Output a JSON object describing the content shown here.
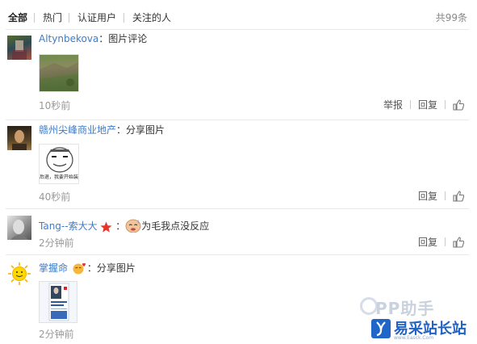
{
  "tabs": [
    {
      "label": "全部",
      "active": true
    },
    {
      "label": "热门",
      "active": false
    },
    {
      "label": "认证用户",
      "active": false
    },
    {
      "label": "关注的人",
      "active": false
    }
  ],
  "total": "共99条",
  "actions": {
    "report": "举报",
    "reply": "回复"
  },
  "comments": [
    {
      "user": "Altynbekova",
      "text": "：图片评论",
      "time": "10秒前",
      "has_report": true,
      "avatar_icon": "avatar-icon",
      "image": "landscape-photo"
    },
    {
      "user": "赣州尖峰商业地产",
      "text": "：分享图片",
      "time": "40秒前",
      "has_report": false,
      "avatar_icon": "avatar-icon",
      "image": "meme-image",
      "image_caption": "后退，我要开始装逼了"
    },
    {
      "user": "Tang--索大大",
      "text": "为毛我点没反应",
      "time": "2分钟前",
      "has_report": false,
      "avatar_icon": "avatar-icon",
      "badge_icon": "star-icon",
      "emoji_icon": "sweat-emoji-icon"
    },
    {
      "user": "掌握命",
      "text": "：分享图片",
      "time": "2分钟前",
      "has_report": false,
      "avatar_icon": "sun-avatar-icon",
      "badge_icon": "heart-emoji-icon",
      "image": "book-cover-image"
    }
  ],
  "watermarks": {
    "top": "PP助手",
    "bottom": "易采站长站",
    "bottom_sub": "www.Easck.Com"
  },
  "colors": {
    "link": "#3e7bc8",
    "time": "#999999",
    "divider": "#e8e8e8",
    "watermark_blue": "#2162c2"
  }
}
